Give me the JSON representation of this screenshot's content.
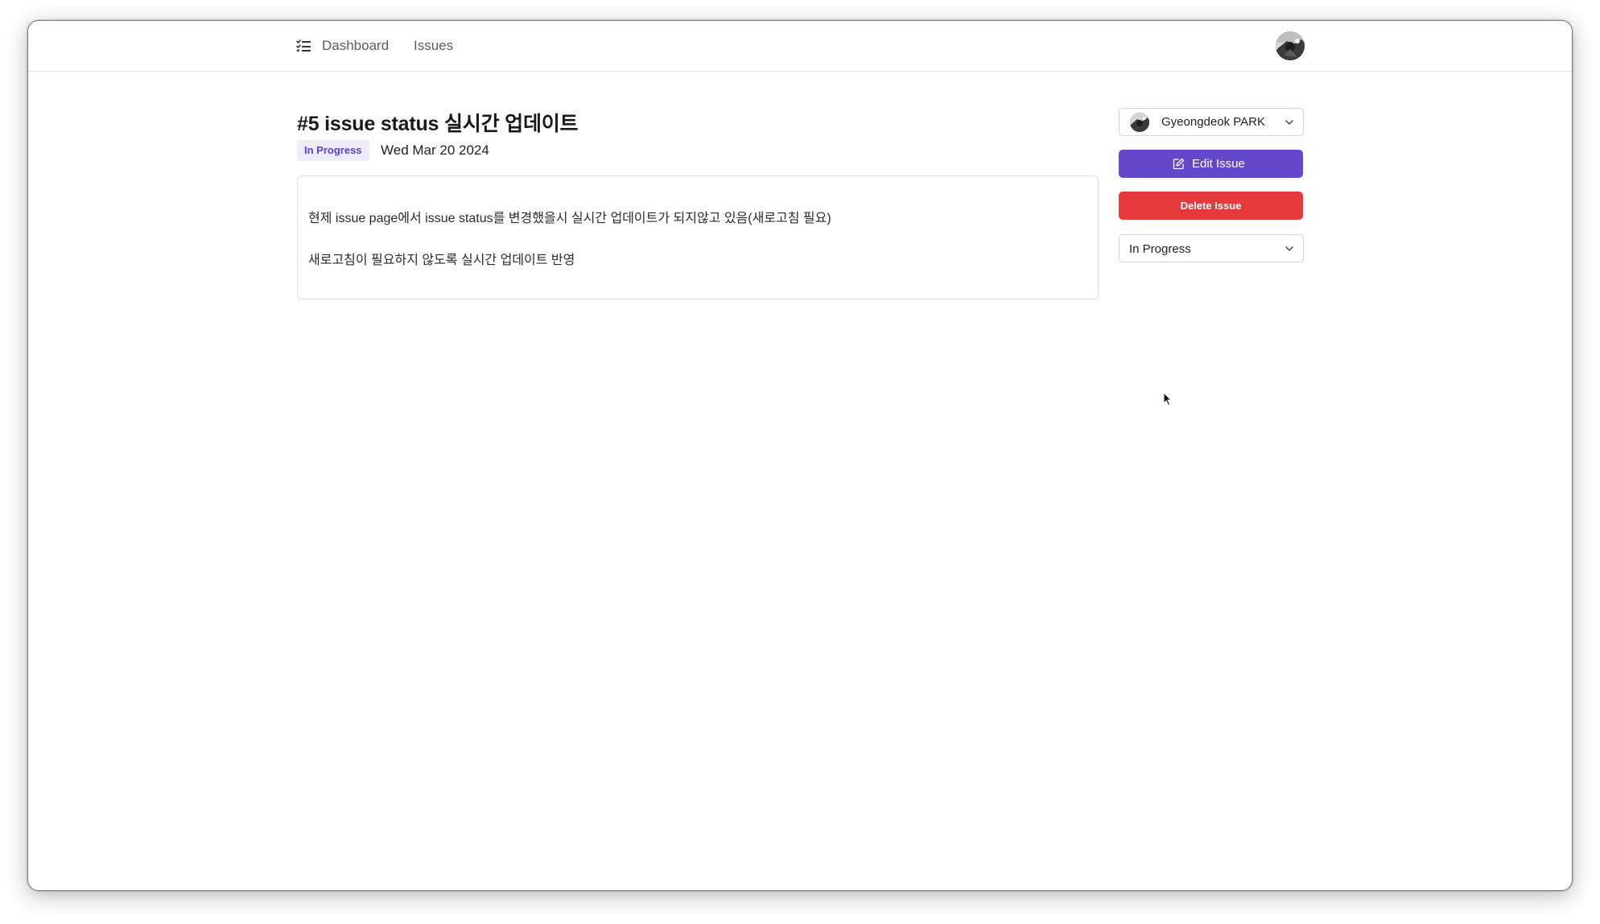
{
  "nav": {
    "logo_icon": "checklist-icon",
    "links": [
      {
        "label": "Dashboard"
      },
      {
        "label": "Issues"
      }
    ],
    "user_avatar_icon": "avatar-photo"
  },
  "issue": {
    "title": "#5 issue status 실시간 업데이트",
    "status_badge": "In Progress",
    "date": "Wed Mar 20 2024",
    "description": [
      "현제 issue page에서 issue status를 변경했을시 실시간 업데이트가 되지않고 있음(새로고침 필요)",
      "새로고침이 필요하지 않도록 실시간 업데이트 반영"
    ]
  },
  "sidebar": {
    "assignee": {
      "name": "Gyeongdeok PARK",
      "avatar_icon": "avatar-photo",
      "chevron_icon": "chevron-down-icon"
    },
    "edit_button": {
      "label": "Edit Issue",
      "icon": "edit-icon"
    },
    "delete_button": {
      "label": "Delete Issue"
    },
    "status_select": {
      "value": "In Progress",
      "chevron_icon": "chevron-down-icon"
    }
  },
  "colors": {
    "accent": "#6548c9",
    "danger": "#e5393b",
    "badge_text": "#5b3fc7",
    "badge_bg": "#efebfb"
  }
}
